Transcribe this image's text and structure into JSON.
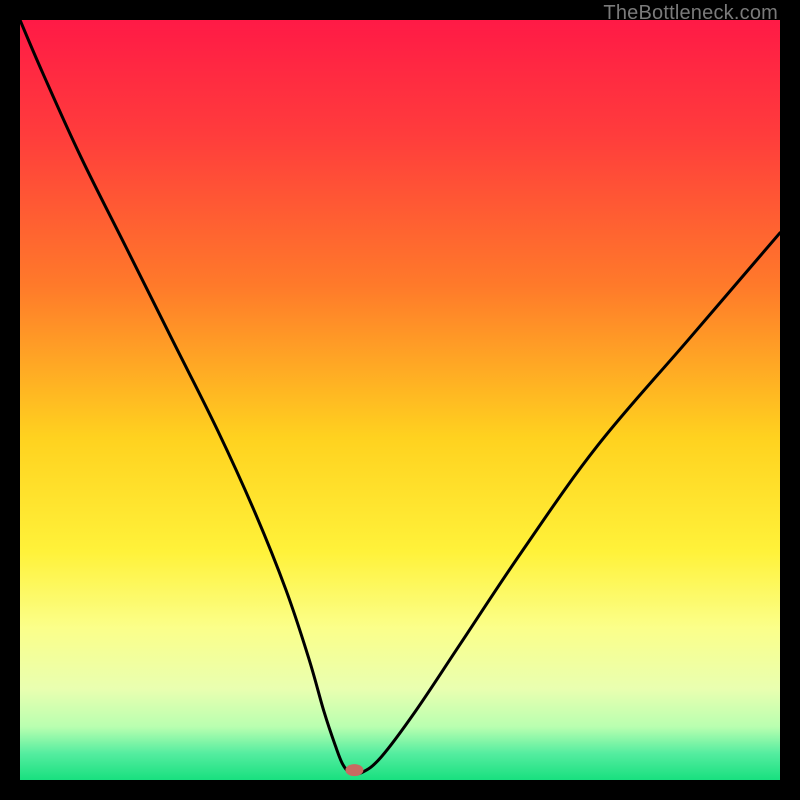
{
  "watermark": "TheBottleneck.com",
  "chart_data": {
    "type": "line",
    "title": "",
    "xlabel": "",
    "ylabel": "",
    "xlim": [
      0,
      100
    ],
    "ylim": [
      0,
      100
    ],
    "background": {
      "type": "gradient-vertical",
      "stops": [
        {
          "pos": 0.0,
          "color": "#ff1a46"
        },
        {
          "pos": 0.15,
          "color": "#ff3c3c"
        },
        {
          "pos": 0.35,
          "color": "#ff7a2a"
        },
        {
          "pos": 0.55,
          "color": "#ffd21f"
        },
        {
          "pos": 0.7,
          "color": "#fff23a"
        },
        {
          "pos": 0.8,
          "color": "#fbff8a"
        },
        {
          "pos": 0.88,
          "color": "#e9ffb0"
        },
        {
          "pos": 0.93,
          "color": "#b9ffb0"
        },
        {
          "pos": 0.965,
          "color": "#55eda0"
        },
        {
          "pos": 1.0,
          "color": "#18e07f"
        }
      ]
    },
    "series": [
      {
        "name": "bottleneck-curve",
        "x": [
          0,
          3,
          8,
          14,
          20,
          26,
          31,
          35,
          38,
          40,
          41.5,
          42.5,
          43.5,
          45,
          47.5,
          52,
          58,
          66,
          76,
          88,
          100
        ],
        "y": [
          100,
          93,
          82,
          70,
          58,
          46,
          35,
          25,
          16,
          9,
          4.5,
          2,
          1,
          1,
          3,
          9,
          18,
          30,
          44,
          58,
          72
        ]
      }
    ],
    "marker": {
      "x": 44,
      "y": 1.3,
      "color": "#c76a61",
      "rx": 9,
      "ry": 6
    }
  }
}
